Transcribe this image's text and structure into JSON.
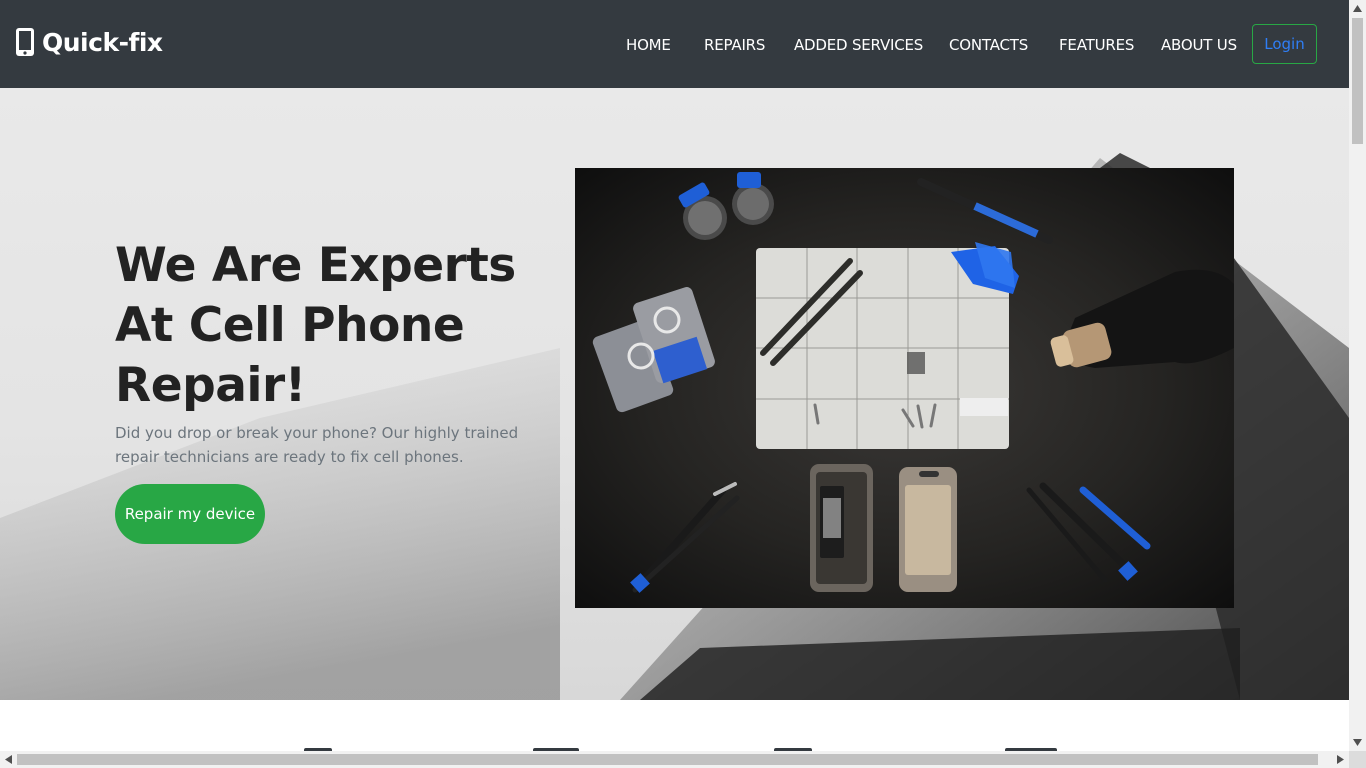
{
  "brand": {
    "name": "Quick-fix",
    "icon": "mobile-phone-icon"
  },
  "nav": {
    "items": [
      {
        "label": "HOME"
      },
      {
        "label": "REPAIRS"
      },
      {
        "label": "ADDED SERVICES"
      },
      {
        "label": "CONTACTS"
      },
      {
        "label": "FEATURES"
      },
      {
        "label": "ABOUT US"
      }
    ],
    "login_label": "Login"
  },
  "hero": {
    "title": "We Are Experts At Cell Phone Repair!",
    "subtitle": "Did you drop or break your phone? Our highly trained repair technicians are ready to fix cell phones.",
    "cta_label": "Repair my device",
    "image": "phone-repair-tools-photo"
  },
  "colors": {
    "navbar": "#343a40",
    "accent_green": "#28a745",
    "login_text": "#2f7ef6",
    "tool_blue": "#1f5fd6"
  }
}
